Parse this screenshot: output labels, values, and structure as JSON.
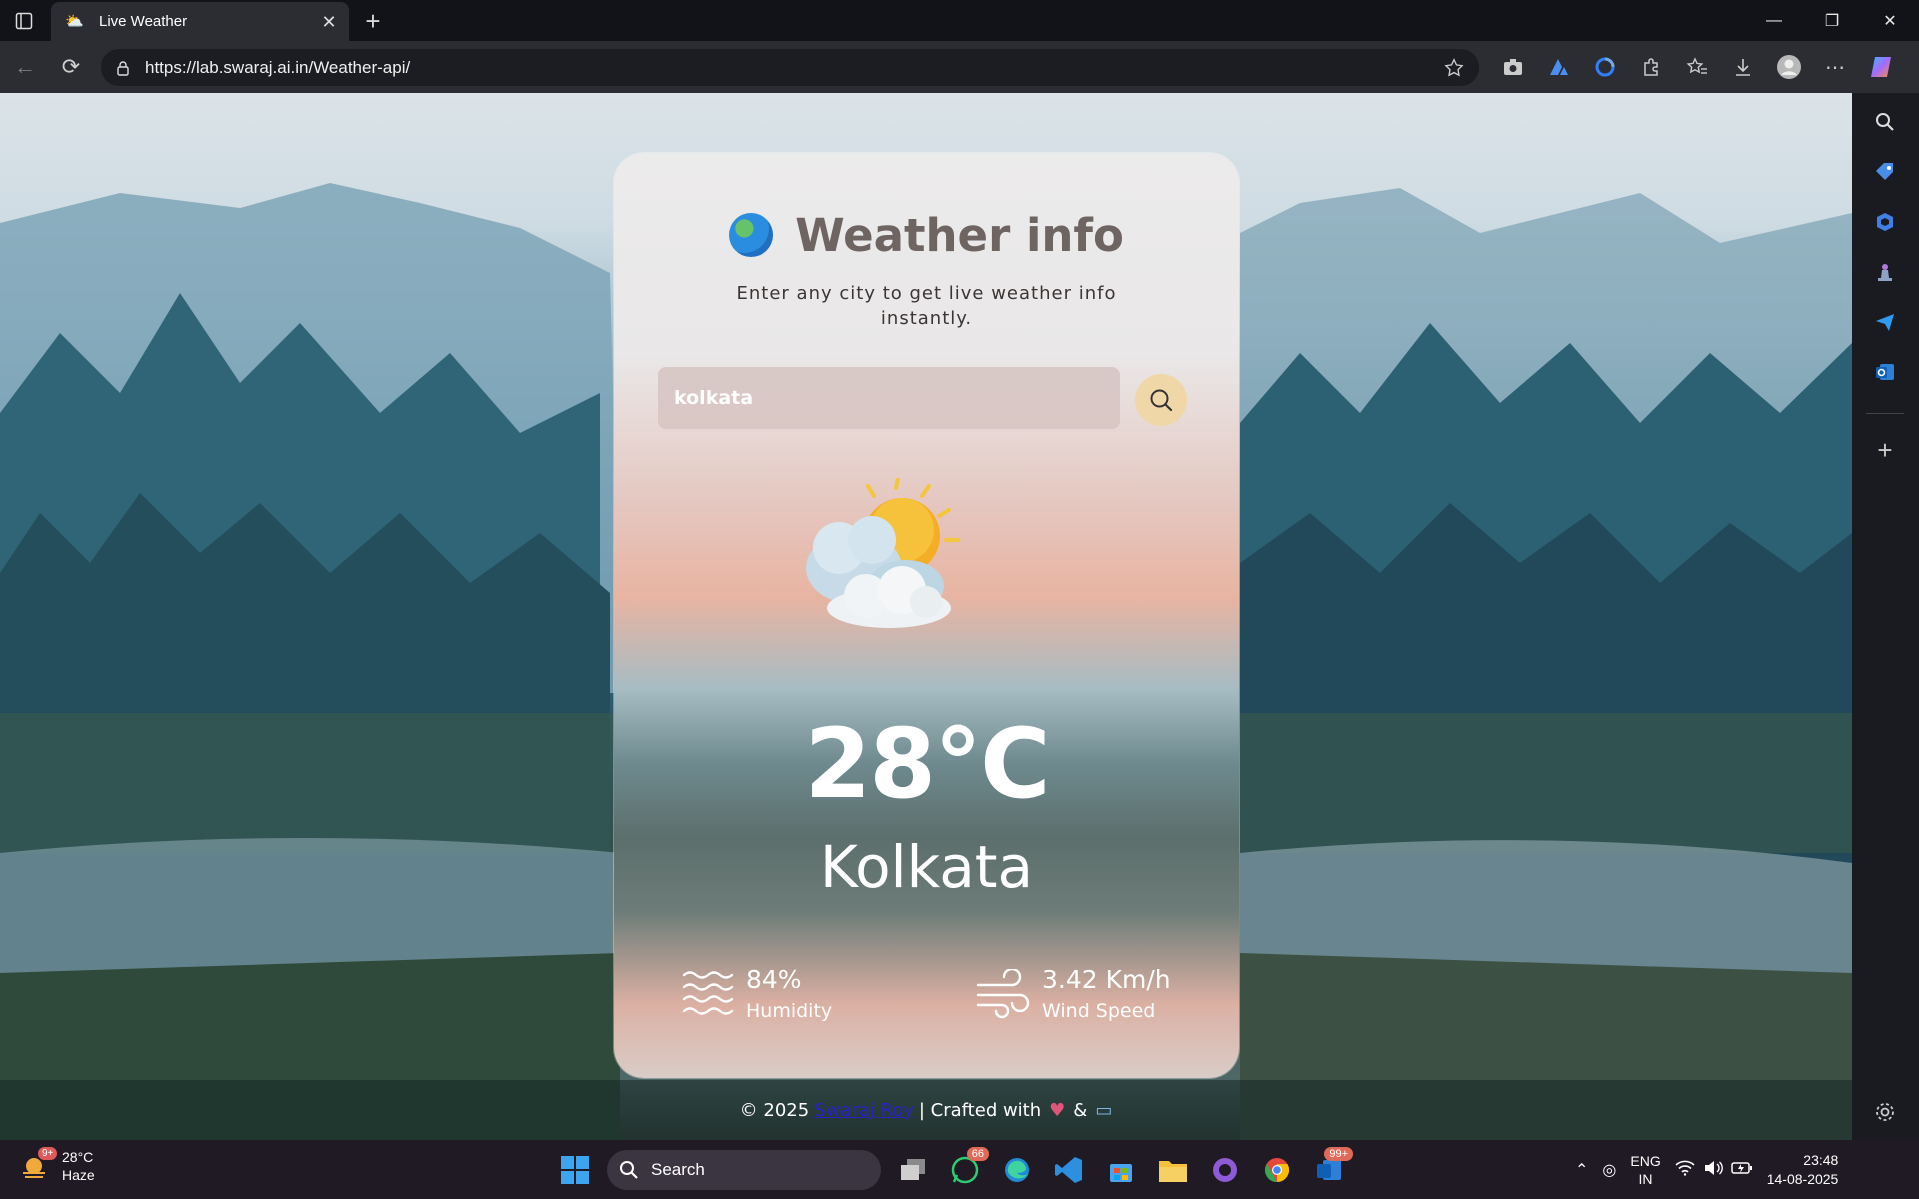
{
  "browser": {
    "tab_title": "Live Weather",
    "url": "https://lab.swaraj.ai.in/Weather-api/"
  },
  "weather_app": {
    "title": "Weather info",
    "subtitle": "Enter any city to get live weather info instantly.",
    "search_value": "kolkata",
    "temperature": "28°C",
    "city": "Kolkata",
    "humidity_value": "84%",
    "humidity_label": "Humidity",
    "wind_value": "3.42 Km/h",
    "wind_label": "Wind Speed",
    "weather_icon": "sun-behind-clouds-icon"
  },
  "footer": {
    "prefix": "© 2025",
    "author": "Swaraj Roy",
    "crafted": "| Crafted with",
    "amp": "&"
  },
  "taskbar": {
    "weather_temp": "28°C",
    "weather_desc": "Haze",
    "weather_badge": "9+",
    "search_label": "Search",
    "whatsapp_badge": "66",
    "outlook_badge": "99+",
    "lang_top": "ENG",
    "lang_bottom": "IN",
    "time": "23:48",
    "date": "14-08-2025"
  },
  "colors": {
    "accent_button": "#f0d7a8",
    "footer_link": "#2a21c9"
  }
}
